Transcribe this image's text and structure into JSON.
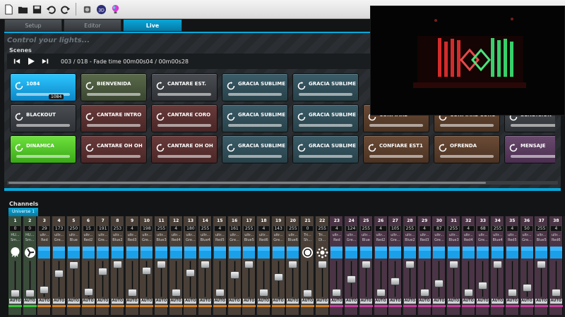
{
  "tabs": [
    {
      "label": "Setup"
    },
    {
      "label": "Editor"
    },
    {
      "label": "Live"
    }
  ],
  "control_title": "Control your lights...",
  "scenes": {
    "label": "Scenes",
    "position": "003 / 018 - Fade time 00m00s04 / 00m00s28",
    "items": [
      {
        "name": "1084",
        "color": "#1aa9e6",
        "tag": "1084"
      },
      {
        "name": "BIENVENIDA",
        "color": "#4f5d42"
      },
      {
        "name": "CANTARE EST.",
        "color": "#3e4145"
      },
      {
        "name": "GRACIA SUBLIME E...",
        "color": "#324f59"
      },
      {
        "name": "GRACIA SUBLIME C...",
        "color": "#324f59"
      },
      {
        "name": "BLACKOUT",
        "color": "#3e4145"
      },
      {
        "name": "CANTARE INTRO",
        "color": "#5a3131"
      },
      {
        "name": "CANTARE CORO",
        "color": "#5a3131"
      },
      {
        "name": "GRACIA SUBLIME E...",
        "color": "#324f59"
      },
      {
        "name": "GRACIA SUBLIME O...",
        "color": "#324f59"
      },
      {
        "name": "CONFIARE",
        "color": "#5b3f2c"
      },
      {
        "name": "CONFIARE CORO",
        "color": "#5b3f2c"
      },
      {
        "name": "BENDICION",
        "color": "#3e4145"
      },
      {
        "name": "DINAMICA",
        "color": "#55c72b"
      },
      {
        "name": "CANTARE OH OH",
        "color": "#5a3131"
      },
      {
        "name": "CANTARE OH OH",
        "color": "#5a3131"
      },
      {
        "name": "GRACIA SUBLIME P...",
        "color": "#324f59"
      },
      {
        "name": "GRACIA SUBLIME P...",
        "color": "#324f59"
      },
      {
        "name": "CONFIARE EST1",
        "color": "#5b3f2c"
      },
      {
        "name": "OFRENDA",
        "color": "#5b3f2c"
      },
      {
        "name": "MENSAJE",
        "color": "#5a3c5e"
      }
    ]
  },
  "channels": {
    "label": "Channels",
    "universe": "Universe 1",
    "auto_label": "AUTO",
    "items": [
      {
        "num": "1",
        "val": "0",
        "lbl1": "HU...",
        "lbl2": "Sm...",
        "level": 0,
        "stripe": "#3ac13a",
        "bg": "#3a4d3a",
        "icon": "snow"
      },
      {
        "num": "2",
        "val": "0",
        "lbl1": "HU...",
        "lbl2": "Sm...",
        "level": 0,
        "stripe": "#3ac13a",
        "bg": "#3a4d3a",
        "icon": "fan"
      },
      {
        "num": "3",
        "val": "29",
        "lbl1": "ultr...",
        "lbl2": "Red",
        "level": 0.11,
        "stripe": "#d27f26",
        "bg": "#4a4038",
        "icon": "bar"
      },
      {
        "num": "4",
        "val": "173",
        "lbl1": "ultr...",
        "lbl2": "Gre...",
        "level": 0.68,
        "stripe": "#d27f26",
        "bg": "#4a4038",
        "icon": "bar"
      },
      {
        "num": "5",
        "val": "250",
        "lbl1": "ultr...",
        "lbl2": "Blue",
        "level": 0.98,
        "stripe": "#d27f26",
        "bg": "#4a4038",
        "icon": "bar"
      },
      {
        "num": "6",
        "val": "15",
        "lbl1": "ultr...",
        "lbl2": "Red2",
        "level": 0.06,
        "stripe": "#d27f26",
        "bg": "#4a4038",
        "icon": "bar"
      },
      {
        "num": "7",
        "val": "191",
        "lbl1": "ultr...",
        "lbl2": "Gre...",
        "level": 0.75,
        "stripe": "#d27f26",
        "bg": "#4a4038",
        "icon": "bar"
      },
      {
        "num": "8",
        "val": "253",
        "lbl1": "ultr...",
        "lbl2": "Blue2",
        "level": 0.99,
        "stripe": "#d27f26",
        "bg": "#4a4038",
        "icon": "bar"
      },
      {
        "num": "9",
        "val": "4",
        "lbl1": "ultr...",
        "lbl2": "Red3",
        "level": 0.02,
        "stripe": "#d27f26",
        "bg": "#4a4038",
        "icon": "bar"
      },
      {
        "num": "10",
        "val": "198",
        "lbl1": "ultr...",
        "lbl2": "Gre...",
        "level": 0.78,
        "stripe": "#d27f26",
        "bg": "#4a4038",
        "icon": "bar"
      },
      {
        "num": "11",
        "val": "255",
        "lbl1": "ultr...",
        "lbl2": "Blue3",
        "level": 1.0,
        "stripe": "#d27f26",
        "bg": "#4a4038",
        "icon": "bar"
      },
      {
        "num": "12",
        "val": "4",
        "lbl1": "ultr...",
        "lbl2": "Red4",
        "level": 0.02,
        "stripe": "#d27f26",
        "bg": "#4a4038",
        "icon": "bar"
      },
      {
        "num": "13",
        "val": "180",
        "lbl1": "ultr...",
        "lbl2": "Gre...",
        "level": 0.71,
        "stripe": "#d27f26",
        "bg": "#4a4038",
        "icon": "bar"
      },
      {
        "num": "14",
        "val": "255",
        "lbl1": "ultr...",
        "lbl2": "Blue4",
        "level": 1.0,
        "stripe": "#d27f26",
        "bg": "#4a4038",
        "icon": "bar"
      },
      {
        "num": "15",
        "val": "4",
        "lbl1": "ultr...",
        "lbl2": "Red5",
        "level": 0.02,
        "stripe": "#d27f26",
        "bg": "#4a4038",
        "icon": "bar"
      },
      {
        "num": "16",
        "val": "161",
        "lbl1": "ultr...",
        "lbl2": "Gre...",
        "level": 0.63,
        "stripe": "#d27f26",
        "bg": "#4a4038",
        "icon": "bar"
      },
      {
        "num": "17",
        "val": "255",
        "lbl1": "ultr...",
        "lbl2": "Blue5",
        "level": 1.0,
        "stripe": "#d27f26",
        "bg": "#4a4038",
        "icon": "bar"
      },
      {
        "num": "18",
        "val": "4",
        "lbl1": "ultr...",
        "lbl2": "Red6",
        "level": 0.02,
        "stripe": "#d27f26",
        "bg": "#4a4038",
        "icon": "bar"
      },
      {
        "num": "19",
        "val": "143",
        "lbl1": "ultr...",
        "lbl2": "Gre...",
        "level": 0.56,
        "stripe": "#d27f26",
        "bg": "#4a4038",
        "icon": "bar"
      },
      {
        "num": "20",
        "val": "255",
        "lbl1": "ultr...",
        "lbl2": "Blue6",
        "level": 1.0,
        "stripe": "#d27f26",
        "bg": "#4a4038",
        "icon": "bar"
      },
      {
        "num": "21",
        "val": "0",
        "lbl1": "Tri...",
        "lbl2": "Sh...",
        "level": 0,
        "stripe": "#d27f26",
        "bg": "#4a4038",
        "icon": "circle"
      },
      {
        "num": "22",
        "val": "255",
        "lbl1": "Tri...",
        "lbl2": "Di...",
        "level": 1.0,
        "stripe": "#d27f26",
        "bg": "#4a4038",
        "icon": "burst"
      },
      {
        "num": "23",
        "val": "4",
        "lbl1": "ultr...",
        "lbl2": "Red",
        "level": 0.02,
        "stripe": "#c23e9c",
        "bg": "#4a3445",
        "icon": "bar"
      },
      {
        "num": "24",
        "val": "124",
        "lbl1": "ultr...",
        "lbl2": "Gre...",
        "level": 0.49,
        "stripe": "#c23e9c",
        "bg": "#4a3445",
        "icon": "bar"
      },
      {
        "num": "25",
        "val": "255",
        "lbl1": "ultr...",
        "lbl2": "Blue",
        "level": 1.0,
        "stripe": "#c23e9c",
        "bg": "#4a3445",
        "icon": "bar"
      },
      {
        "num": "26",
        "val": "4",
        "lbl1": "ultr...",
        "lbl2": "Red2",
        "level": 0.02,
        "stripe": "#c23e9c",
        "bg": "#4a3445",
        "icon": "bar"
      },
      {
        "num": "27",
        "val": "105",
        "lbl1": "ultr...",
        "lbl2": "Gre...",
        "level": 0.41,
        "stripe": "#c23e9c",
        "bg": "#4a3445",
        "icon": "bar"
      },
      {
        "num": "28",
        "val": "255",
        "lbl1": "ultr...",
        "lbl2": "Blue2",
        "level": 1.0,
        "stripe": "#c23e9c",
        "bg": "#4a3445",
        "icon": "bar"
      },
      {
        "num": "29",
        "val": "4",
        "lbl1": "ultr...",
        "lbl2": "Red3",
        "level": 0.02,
        "stripe": "#c23e9c",
        "bg": "#4a3445",
        "icon": "bar"
      },
      {
        "num": "30",
        "val": "87",
        "lbl1": "ultr...",
        "lbl2": "Gre...",
        "level": 0.34,
        "stripe": "#c23e9c",
        "bg": "#4a3445",
        "icon": "bar"
      },
      {
        "num": "31",
        "val": "255",
        "lbl1": "ultr...",
        "lbl2": "Blue3",
        "level": 1.0,
        "stripe": "#c23e9c",
        "bg": "#4a3445",
        "icon": "bar"
      },
      {
        "num": "32",
        "val": "4",
        "lbl1": "ultr...",
        "lbl2": "Red4",
        "level": 0.02,
        "stripe": "#c23e9c",
        "bg": "#4a3445",
        "icon": "bar"
      },
      {
        "num": "33",
        "val": "68",
        "lbl1": "ultr...",
        "lbl2": "Gre...",
        "level": 0.27,
        "stripe": "#c23e9c",
        "bg": "#4a3445",
        "icon": "bar"
      },
      {
        "num": "34",
        "val": "255",
        "lbl1": "ultr...",
        "lbl2": "Blue4",
        "level": 1.0,
        "stripe": "#c23e9c",
        "bg": "#4a3445",
        "icon": "bar"
      },
      {
        "num": "35",
        "val": "4",
        "lbl1": "ultr...",
        "lbl2": "Red5",
        "level": 0.02,
        "stripe": "#c23e9c",
        "bg": "#4a3445",
        "icon": "bar"
      },
      {
        "num": "36",
        "val": "50",
        "lbl1": "ultr...",
        "lbl2": "Gre...",
        "level": 0.2,
        "stripe": "#c23e9c",
        "bg": "#4a3445",
        "icon": "bar"
      },
      {
        "num": "37",
        "val": "255",
        "lbl1": "ultr...",
        "lbl2": "Blue5",
        "level": 1.0,
        "stripe": "#c23e9c",
        "bg": "#4a3445",
        "icon": "bar"
      },
      {
        "num": "38",
        "val": "4",
        "lbl1": "ultr...",
        "lbl2": "Red6",
        "level": 0.02,
        "stripe": "#c23e9c",
        "bg": "#4a3445",
        "icon": "bar"
      }
    ]
  },
  "toolbar": {
    "icons": [
      "new-file-icon",
      "open-folder-icon",
      "save-icon",
      "undo-icon",
      "redo-icon",
      "view-3d-icon",
      "color-bulb-icon"
    ]
  },
  "colors": {
    "accent": "#0aa7d8",
    "live_tab": "#0aa7d8"
  }
}
